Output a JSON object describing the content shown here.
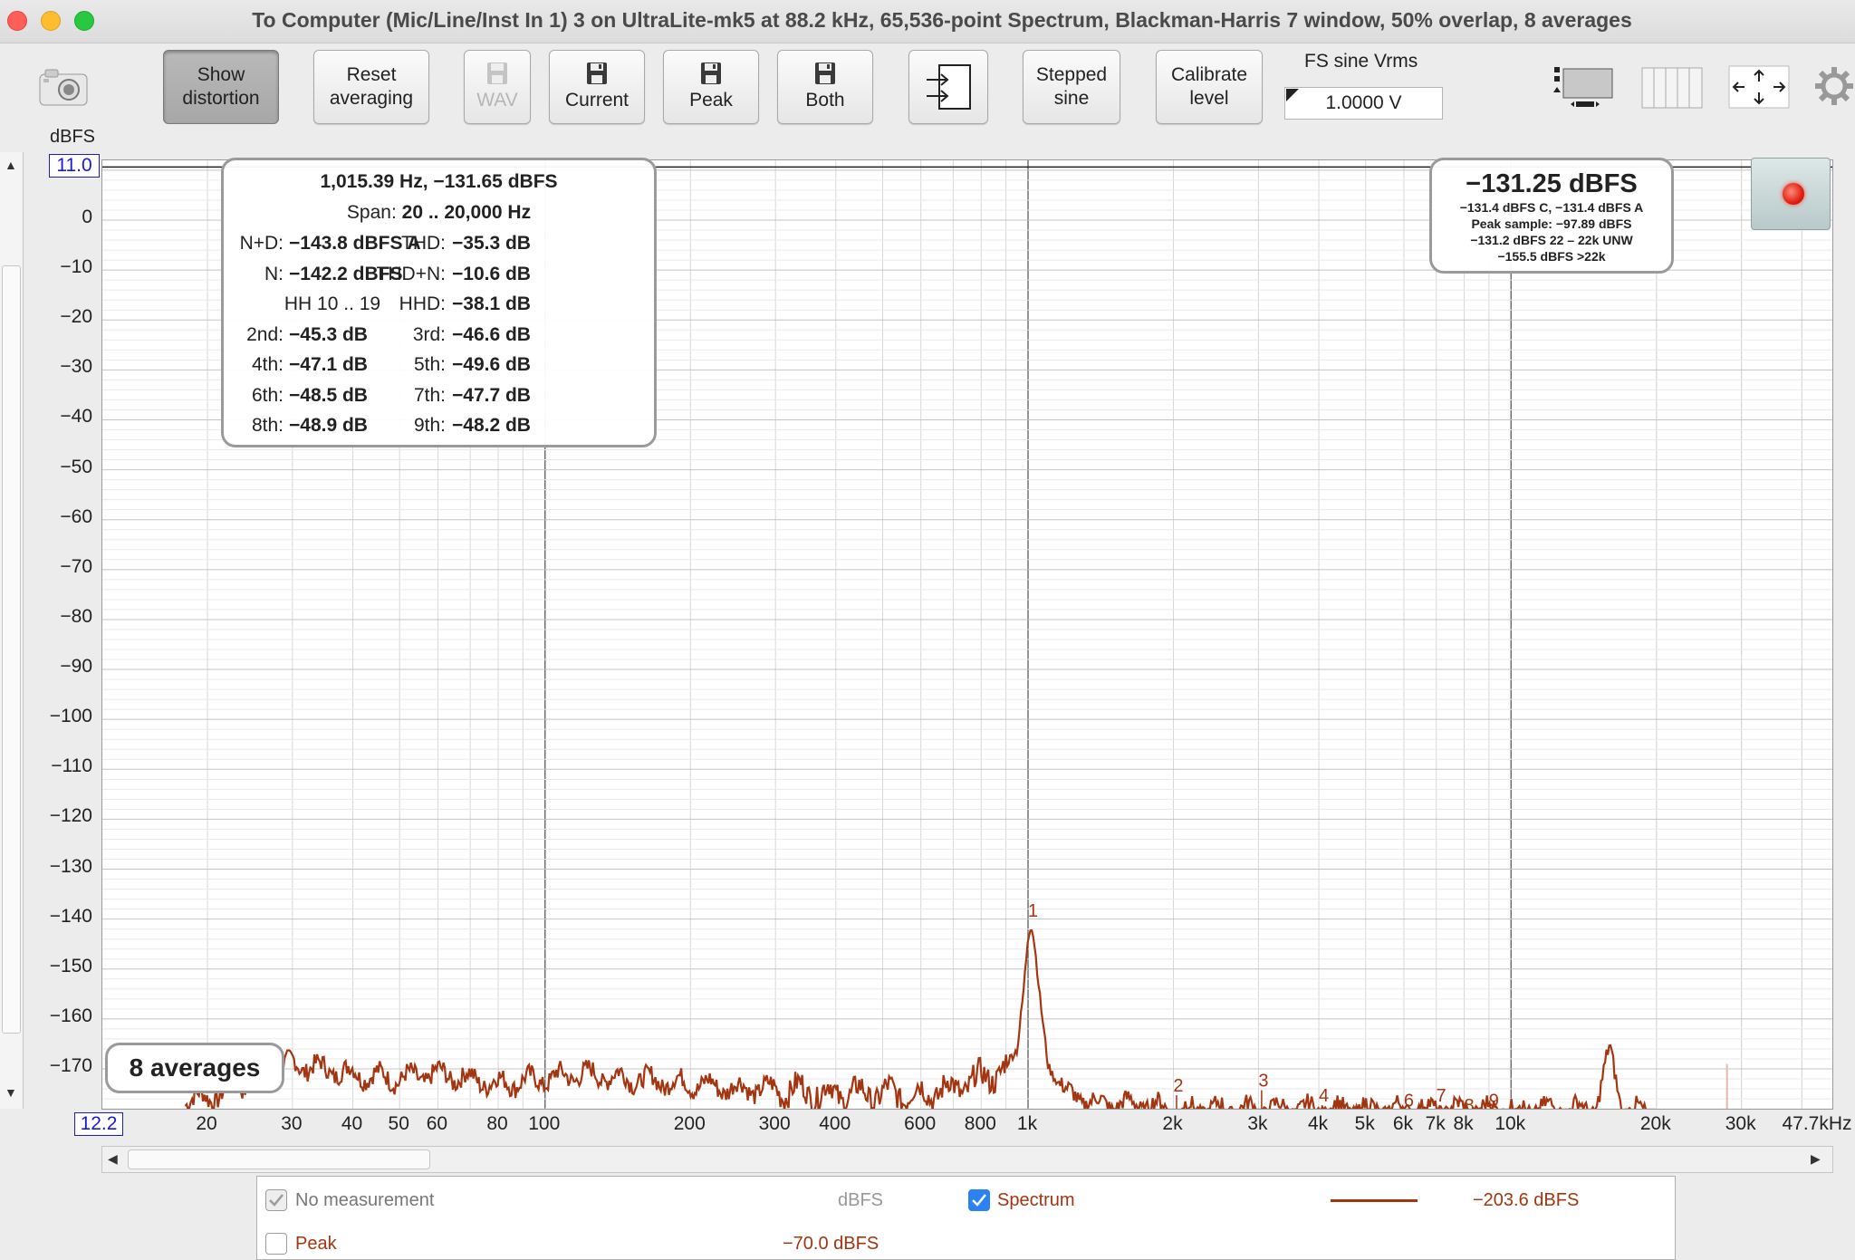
{
  "window": {
    "title": "To Computer (Mic/Line/Inst In 1) 3 on UltraLite-mk5 at 88.2 kHz, 65,536-point Spectrum, Blackman-Harris 7 window, 50% overlap, 8 averages"
  },
  "toolbar": {
    "show_distortion": [
      "Show",
      "distortion"
    ],
    "reset_averaging": [
      "Reset",
      "averaging"
    ],
    "wav": "WAV",
    "current": "Current",
    "peak": "Peak",
    "both": "Both",
    "stepped_sine": [
      "Stepped",
      "sine"
    ],
    "calibrate_level": [
      "Calibrate",
      "level"
    ],
    "fs_label": "FS sine Vrms",
    "fs_value": "1.0000 V"
  },
  "axes": {
    "y_unit": "dBFS",
    "y_top_box": "11.0",
    "x_left_box": "12.2",
    "y_ticks": [
      "0",
      "−10",
      "−20",
      "−30",
      "−40",
      "−50",
      "−60",
      "−70",
      "−80",
      "−90",
      "−100",
      "−110",
      "−120",
      "−130",
      "−140",
      "−150",
      "−160",
      "−170"
    ],
    "x_ticks": [
      "20",
      "30",
      "40",
      "50",
      "60",
      "80",
      "100",
      "200",
      "300",
      "400",
      "600",
      "800",
      "1k",
      "2k",
      "3k",
      "4k",
      "5k",
      "6k",
      "7k",
      "8k",
      "10k",
      "20k",
      "30k",
      "47.7kHz"
    ]
  },
  "distortion": {
    "header": "1,015.39 Hz, −131.65 dBFS",
    "span_label": "Span:",
    "span_value": "20 .. 20,000 Hz",
    "rows": [
      {
        "l_label": "N+D:",
        "l_value": "−143.8 dBFS A",
        "r_label": "THD:",
        "r_value": "−35.3 dB"
      },
      {
        "l_label": "N:",
        "l_value": "−142.2 dBFS",
        "r_label": "THD+N:",
        "r_value": "−10.6 dB"
      },
      {
        "l_label": "HH 10 .. 19",
        "l_value": "",
        "r_label": "HHD:",
        "r_value": "−38.1 dB"
      },
      {
        "l_label": "2nd:",
        "l_value": "−45.3 dB",
        "r_label": "3rd:",
        "r_value": "−46.6 dB"
      },
      {
        "l_label": "4th:",
        "l_value": "−47.1 dB",
        "r_label": "5th:",
        "r_value": "−49.6 dB"
      },
      {
        "l_label": "6th:",
        "l_value": "−48.5 dB",
        "r_label": "7th:",
        "r_value": "−47.7 dB"
      },
      {
        "l_label": "8th:",
        "l_value": "−48.9 dB",
        "r_label": "9th:",
        "r_value": "−48.2 dB"
      }
    ]
  },
  "level": {
    "big": "−131.25 dBFS",
    "lines": [
      "−131.4 dBFS C, −131.4 dBFS A",
      "Peak sample: −97.89 dBFS",
      "−131.2 dBFS 22 – 22k UNW",
      "−155.5 dBFS >22k"
    ]
  },
  "averages_label": "8 averages",
  "legend": {
    "no_measurement": "No measurement",
    "no_measurement_unit": "dBFS",
    "spectrum": "Spectrum",
    "spectrum_value": "−203.6 dBFS",
    "peak": "Peak",
    "peak_value": "−70.0 dBFS"
  },
  "colors": {
    "trace": "#a33510",
    "harmonic_label": "#a33510",
    "accent_blue": "#1a1ad6",
    "checkbox_on": "#2a82f5"
  },
  "chart_data": {
    "type": "line",
    "title": "",
    "xlabel": "",
    "ylabel": "dBFS",
    "x_scale": "log",
    "xlim": [
      12.2,
      47700
    ],
    "ylim": [
      -180,
      11
    ],
    "grid": true,
    "series": [
      {
        "name": "Spectrum",
        "x": [
          20,
          25,
          30,
          35,
          40,
          50,
          60,
          70,
          80,
          100,
          120,
          150,
          200,
          250,
          300,
          400,
          500,
          600,
          700,
          800,
          900,
          950,
          980,
          1000,
          1015,
          1030,
          1060,
          1100,
          1200,
          1400,
          1700,
          2000,
          2500,
          3000,
          4000,
          5000,
          6000,
          7000,
          8000,
          10000,
          15000,
          16000,
          17000,
          20000
        ],
        "y": [
          -176,
          -172,
          -169,
          -170,
          -171,
          -172,
          -171,
          -172,
          -173,
          -172,
          -171,
          -172,
          -173,
          -174,
          -174,
          -175,
          -175,
          -175,
          -174,
          -172,
          -170,
          -166,
          -153,
          -143,
          -141,
          -145,
          -157,
          -169,
          -175,
          -177,
          -177,
          -178,
          -178,
          -178,
          -178,
          -178,
          -178,
          -178,
          -178,
          -178,
          -178,
          -166,
          -178,
          -179
        ]
      }
    ],
    "harmonic_markers": [
      {
        "label": "1",
        "x": 1015,
        "y": -141
      },
      {
        "label": "2",
        "x": 2030,
        "y": -176
      },
      {
        "label": "3",
        "x": 3045,
        "y": -175
      },
      {
        "label": "4",
        "x": 4060,
        "y": -178
      },
      {
        "label": "6",
        "x": 6090,
        "y": -179
      },
      {
        "label": "7",
        "x": 7105,
        "y": -178
      },
      {
        "label": "8",
        "x": 8120,
        "y": -180
      },
      {
        "label": "9",
        "x": 9135,
        "y": -179
      }
    ]
  }
}
